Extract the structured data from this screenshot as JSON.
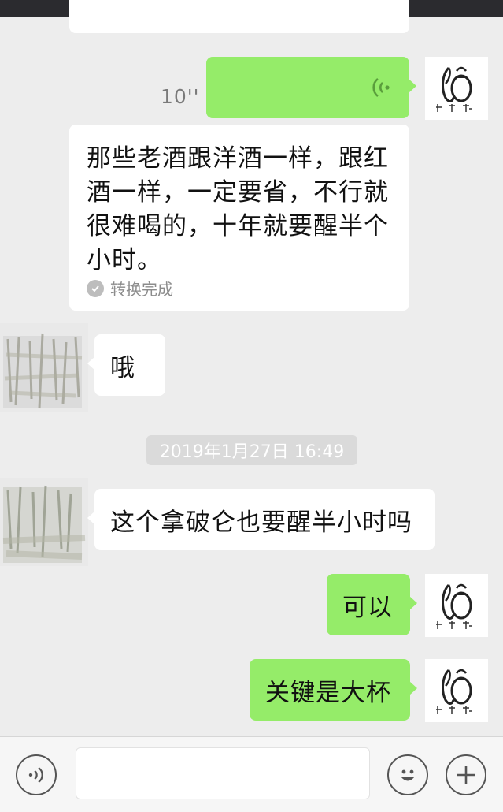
{
  "voice_message": {
    "duration": "10''"
  },
  "transcription": {
    "lines": [
      "那些老酒跟洋酒一样，跟红",
      "酒一样，一定要省，不行就",
      "很难喝的，十年就要醒半个",
      "小时。"
    ],
    "status": "转换完成"
  },
  "messages": {
    "oh": "哦",
    "napoleon": "这个拿破仑也要醒半小时吗",
    "ok": "可以",
    "key": "关键是大杯"
  },
  "timestamp": "2019年1月27日 16:49",
  "input": {
    "placeholder": ""
  },
  "colors": {
    "sent_bubble": "#95ec69",
    "received_bubble": "#ffffff",
    "background": "#ededed"
  }
}
